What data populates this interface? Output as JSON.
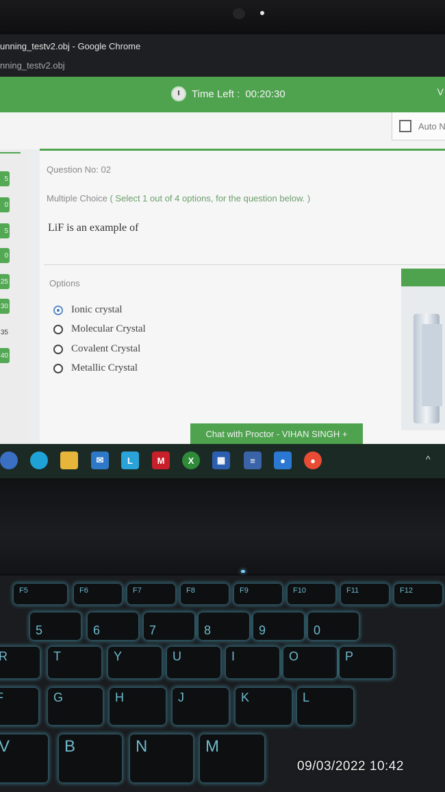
{
  "window": {
    "title": "unning_testv2.obj - Google Chrome",
    "tab": "nning_testv2.obj"
  },
  "header": {
    "time_label": "Time Left :",
    "time_value": "00:20:30",
    "edge_text": "V",
    "auto_next": "Auto N"
  },
  "question_nav": [
    {
      "label": "5"
    },
    {
      "label": "0"
    },
    {
      "label": "5"
    },
    {
      "label": "0"
    },
    {
      "label": "25"
    },
    {
      "label": "30"
    },
    {
      "label": "35"
    },
    {
      "label": "40"
    }
  ],
  "question": {
    "number": "Question No: 02",
    "type": "Multiple Choice",
    "instruction": " ( Select 1 out of 4 options, for the question below. )",
    "text": "LiF is an example of"
  },
  "options": {
    "label": "Options",
    "items": [
      {
        "text": "Ionic crystal",
        "selected": true
      },
      {
        "text": "Molecular Crystal",
        "selected": false
      },
      {
        "text": "Covalent Crystal",
        "selected": false
      },
      {
        "text": "Metallic Crystal",
        "selected": false
      }
    ]
  },
  "chat": {
    "label": "Chat with Proctor - VIHAN SINGH  +"
  },
  "taskbar": {
    "icons": [
      "start-icon",
      "edge-icon",
      "file-explorer-icon",
      "mail-icon",
      "l-app-icon",
      "mcafee-icon",
      "xbox-icon",
      "calculator-icon",
      "news-icon",
      "security-icon",
      "chrome-icon"
    ],
    "chevron": "^"
  },
  "keyboard": {
    "fn_row": [
      "F5",
      "F6",
      "F7",
      "F8",
      "F9",
      "F10",
      "F11",
      "F12"
    ],
    "number_row": [
      "5",
      "6",
      "7",
      "8",
      "9",
      "0"
    ],
    "row_top": [
      "R",
      "T",
      "Y",
      "U",
      "I",
      "O",
      "P"
    ],
    "row_home": [
      "F",
      "G",
      "H",
      "J",
      "K",
      "L"
    ],
    "row_bottom": [
      "V",
      "B",
      "N",
      "M"
    ]
  },
  "photo_timestamp": "09/03/2022 10:42",
  "colors": {
    "accent_green": "#4fa34f",
    "selected_radio": "#3d73b8",
    "keyboard_glow": "#5ac8e6"
  }
}
